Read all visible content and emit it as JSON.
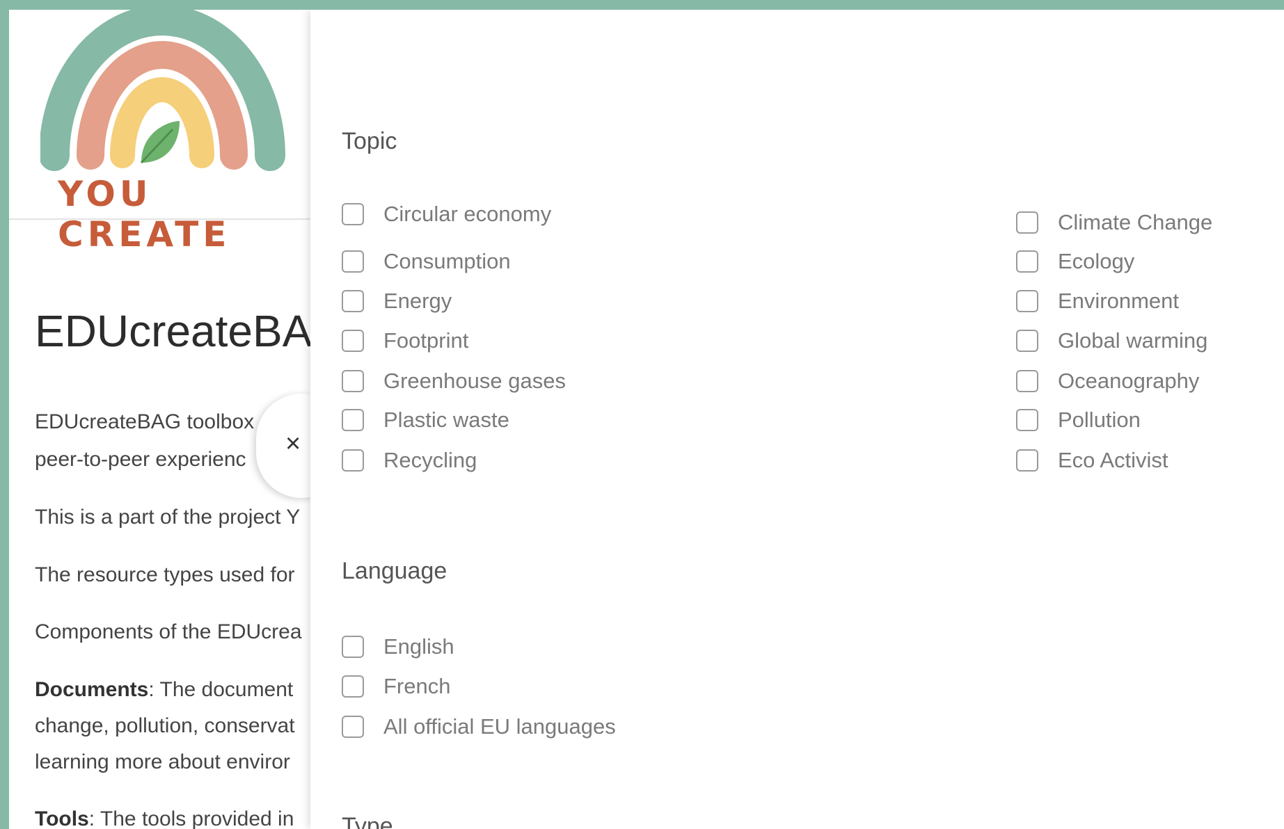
{
  "logo": {
    "text": "YOU CREATE"
  },
  "left": {
    "title": "EDUcreateBA",
    "paragraphs": [
      {
        "text": "EDUcreateBAG toolbox"
      },
      {
        "text": "peer-to-peer experienc"
      },
      {
        "text": "This is a part of the project Y"
      },
      {
        "text": "The resource types used for"
      },
      {
        "text": "Components of the EDUcrea"
      },
      {
        "bold": "Documents",
        "text": ": The document"
      },
      {
        "text": "change, pollution, conservat"
      },
      {
        "text": "learning more about enviror"
      },
      {
        "bold": "Tools",
        "text": ": The tools provided in"
      }
    ]
  },
  "close": {
    "label": "×"
  },
  "filters": {
    "topic": {
      "title": "Topic",
      "left_options": [
        "Circular economy",
        "Consumption",
        "Energy",
        "Footprint",
        "Greenhouse gases",
        "Plastic waste",
        "Recycling"
      ],
      "right_options": [
        "Climate Change",
        "Ecology",
        "Environment",
        "Global warming",
        "Oceanography",
        "Pollution",
        "Eco Activist"
      ]
    },
    "language": {
      "title": "Language",
      "options": [
        "English",
        "French",
        "All official EU languages"
      ]
    },
    "type": {
      "title": "Type"
    }
  },
  "colors": {
    "frame": "#86b9a6",
    "rainbow_outer": "#86b9a6",
    "rainbow_middle": "#e4a08a",
    "rainbow_inner": "#f5cf79",
    "leaf": "#6db26d",
    "logo_text": "#c65c3a"
  },
  "icons": [
    "rainbow-logo-icon",
    "leaf-icon",
    "close-icon",
    "checkbox-icon"
  ]
}
